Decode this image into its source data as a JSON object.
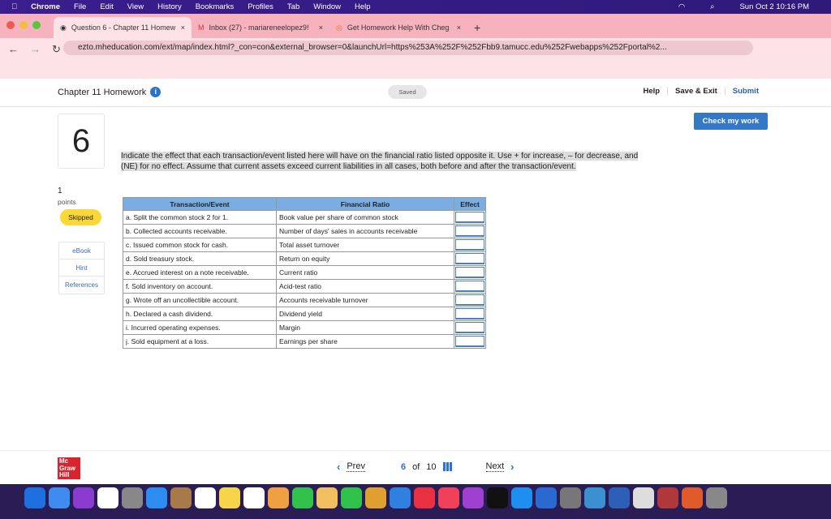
{
  "menubar": {
    "app": "Chrome",
    "items": [
      "File",
      "Edit",
      "View",
      "History",
      "Bookmarks",
      "Profiles",
      "Tab",
      "Window",
      "Help"
    ],
    "clock": "Sun Oct 2  10:16 PM"
  },
  "tabs": [
    {
      "title": "Question 6 - Chapter 11 Homew"
    },
    {
      "title": "Inbox (27) - mariareneelopez9!"
    },
    {
      "title": "Get Homework Help With Cheg"
    }
  ],
  "url": "ezto.mheducation.com/ext/map/index.html?_con=con&external_browser=0&launchUrl=https%253A%252F%252Fbb9.tamucc.edu%252Fwebapps%252Fportal%2...",
  "header": {
    "title": "Chapter 11 Homework",
    "status": "Saved",
    "help": "Help",
    "save_exit": "Save & Exit",
    "submit": "Submit"
  },
  "check_label": "Check my work",
  "question": {
    "number": "6",
    "points": "1",
    "points_label": "points",
    "status": "Skipped",
    "text": "Indicate the effect that each transaction/event listed here will have on the financial ratio listed opposite it. Use + for increase, – for decrease, and (NE) for no effect. Assume that current assets exceed current liabilities in all cases, both before and after the transaction/event."
  },
  "sidebar": [
    "eBook",
    "Hint",
    "References"
  ],
  "table": {
    "headers": [
      "Transaction/Event",
      "Financial Ratio",
      "Effect"
    ],
    "rows": [
      [
        "a. Split the common stock 2 for 1.",
        "Book value per share of common stock"
      ],
      [
        "b. Collected accounts receivable.",
        "Number of days' sales in accounts receivable"
      ],
      [
        "c. Issued common stock for cash.",
        "Total asset turnover"
      ],
      [
        "d. Sold treasury stock.",
        "Return on equity"
      ],
      [
        "e. Accrued interest on a note receivable.",
        "Current ratio"
      ],
      [
        "f. Sold inventory on account.",
        "Acid-test ratio"
      ],
      [
        "g. Wrote off an uncollectible account.",
        "Accounts receivable turnover"
      ],
      [
        "h. Declared a cash dividend.",
        "Dividend yield"
      ],
      [
        "i. Incurred operating expenses.",
        "Margin"
      ],
      [
        "j. Sold equipment at a loss.",
        "Earnings per share"
      ]
    ]
  },
  "footer": {
    "logo": "Mc Graw Hill",
    "prev": "Prev",
    "current": "6",
    "of": "of",
    "total": "10",
    "next": "Next"
  },
  "dock_colors": [
    "#1e6fe0",
    "#3f8bf0",
    "#8a3bd0",
    "#fff",
    "#888",
    "#2d8cf0",
    "#a87a4a",
    "#fff",
    "#f7d54a",
    "#fff",
    "#f0a040",
    "#30c24a",
    "#f0c060",
    "#30c24a",
    "#e0a030",
    "#3080e0",
    "#e83040",
    "#f0405a",
    "#a040d0",
    "#111",
    "#1e8ff0",
    "#2a6ad0",
    "#777",
    "#3a90d0",
    "#2c5fb8",
    "#ddd",
    "#b0383a",
    "#e05a2a",
    "#888"
  ]
}
